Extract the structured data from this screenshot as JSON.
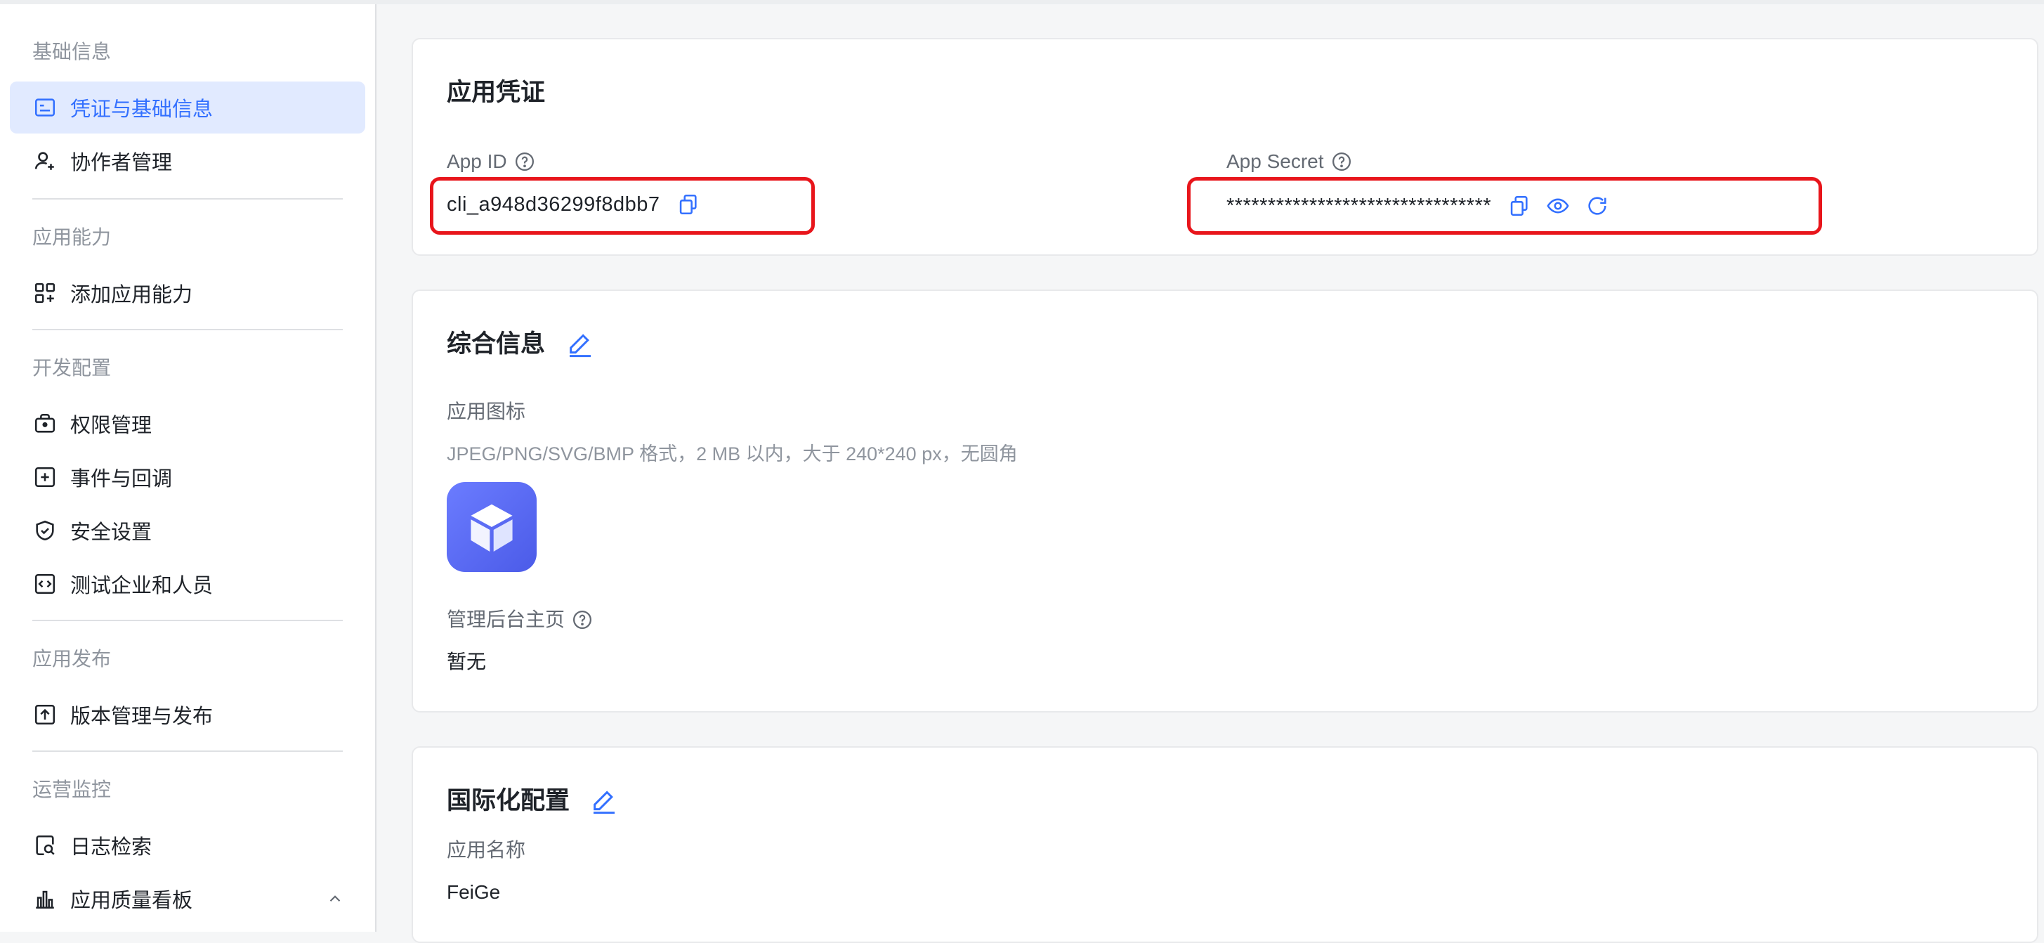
{
  "sidebar": {
    "sections": [
      {
        "title": "基础信息",
        "items": [
          {
            "label": "凭证与基础信息",
            "icon": "credential-card-icon",
            "active": true
          },
          {
            "label": "协作者管理",
            "icon": "user-add-icon"
          }
        ]
      },
      {
        "title": "应用能力",
        "items": [
          {
            "label": "添加应用能力",
            "icon": "grid-add-icon"
          }
        ]
      },
      {
        "title": "开发配置",
        "items": [
          {
            "label": "权限管理",
            "icon": "briefcase-lock-icon"
          },
          {
            "label": "事件与回调",
            "icon": "plus-square-icon"
          },
          {
            "label": "安全设置",
            "icon": "shield-check-icon"
          },
          {
            "label": "测试企业和人员",
            "icon": "code-square-icon"
          }
        ]
      },
      {
        "title": "应用发布",
        "items": [
          {
            "label": "版本管理与发布",
            "icon": "upload-square-icon"
          }
        ]
      },
      {
        "title": "运营监控",
        "items": [
          {
            "label": "日志检索",
            "icon": "log-search-icon"
          },
          {
            "label": "应用质量看板",
            "icon": "bar-chart-icon",
            "expanded": true
          }
        ]
      }
    ]
  },
  "credentials": {
    "title": "应用凭证",
    "app_id_label": "App ID",
    "app_id_value": "cli_a948d36299f8dbb7",
    "app_secret_label": "App Secret",
    "app_secret_value": "********************************"
  },
  "general": {
    "title": "综合信息",
    "icon_label": "应用图标",
    "icon_hint": "JPEG/PNG/SVG/BMP 格式，2 MB 以内，大于 240*240 px，无圆角",
    "admin_home_label": "管理后台主页",
    "admin_home_value": "暂无"
  },
  "i18n": {
    "title": "国际化配置",
    "app_name_label": "应用名称",
    "app_name_value": "FeiGe"
  },
  "colors": {
    "accent": "#3370ff",
    "active_bg": "#e1eaff",
    "highlight_box": "#e8151b",
    "app_icon": "#5b6af0"
  }
}
